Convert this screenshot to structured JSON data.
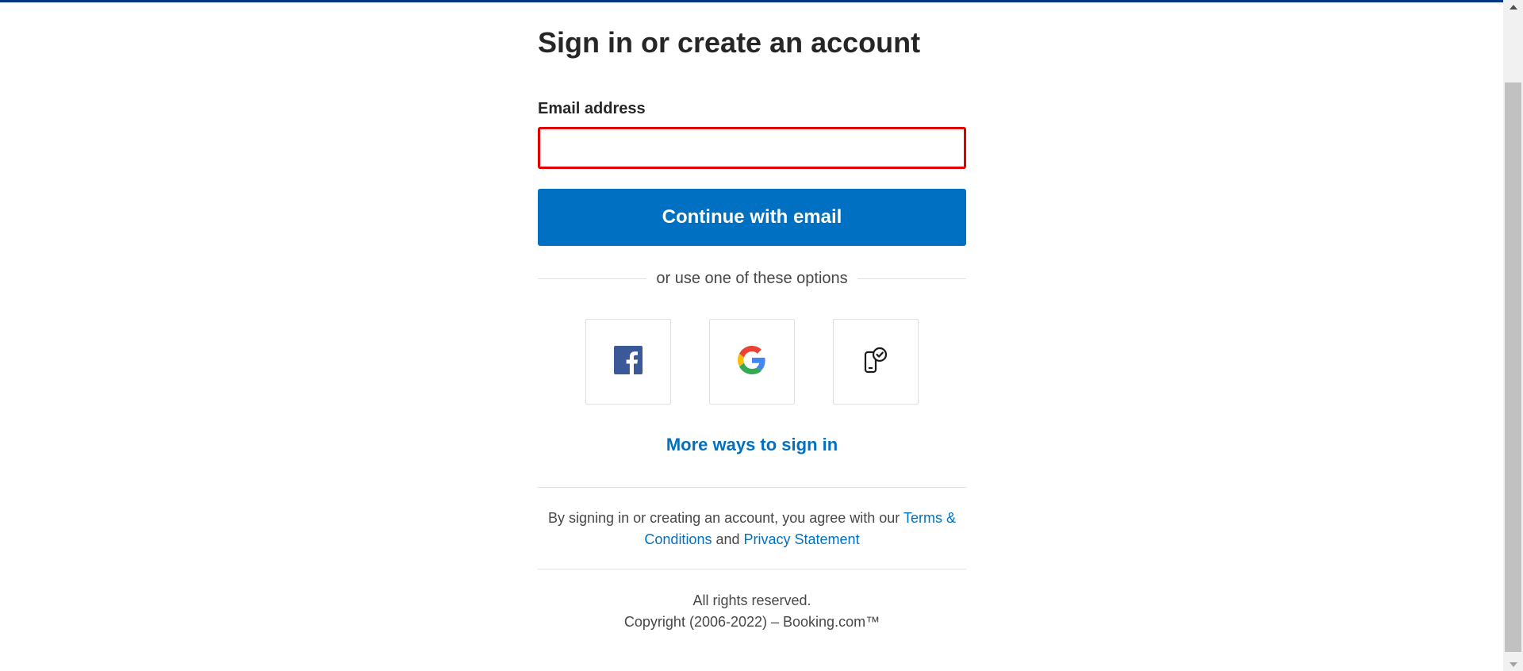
{
  "page": {
    "title": "Sign in or create an account"
  },
  "form": {
    "email_label": "Email address",
    "email_value": "",
    "continue_label": "Continue with email"
  },
  "divider": {
    "text": "or use one of these options"
  },
  "options": [
    {
      "name": "Facebook",
      "icon": "facebook-icon"
    },
    {
      "name": "Google",
      "icon": "google-icon"
    },
    {
      "name": "Device",
      "icon": "device-check-icon"
    }
  ],
  "more_ways": {
    "label": "More ways to sign in"
  },
  "legal": {
    "prefix": "By signing in or creating an account, you agree with our ",
    "terms_link": "Terms & Conditions",
    "joiner": " and ",
    "privacy_link": "Privacy Statement"
  },
  "footer": {
    "rights": "All rights reserved.",
    "copyright": "Copyright (2006-2022) – Booking.com™"
  },
  "colors": {
    "brand_dark": "#003580",
    "primary": "#0071c2",
    "error_border": "#e00000",
    "facebook": "#3b5998"
  }
}
